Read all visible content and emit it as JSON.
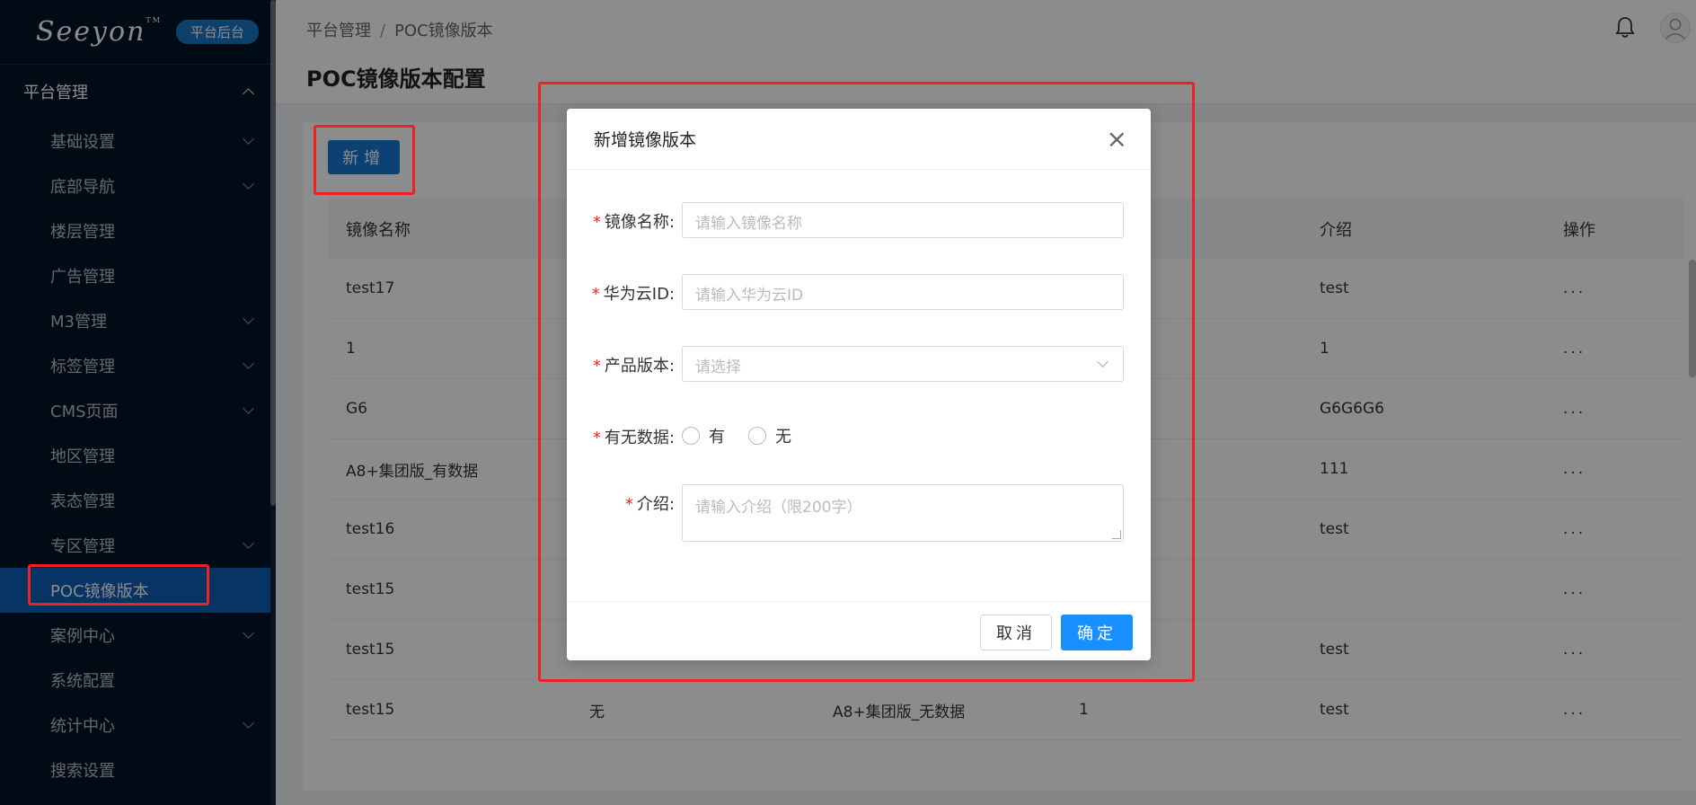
{
  "app": {
    "logo_text": "Seeyon",
    "logo_tm": "TM",
    "badge": "平台后台"
  },
  "sidebar": {
    "group_label": "平台管理",
    "items": [
      {
        "label": "基础设置",
        "has_children": true
      },
      {
        "label": "底部导航",
        "has_children": true
      },
      {
        "label": "楼层管理",
        "has_children": false
      },
      {
        "label": "广告管理",
        "has_children": false
      },
      {
        "label": "M3管理",
        "has_children": true
      },
      {
        "label": "标签管理",
        "has_children": true
      },
      {
        "label": "CMS页面",
        "has_children": true
      },
      {
        "label": "地区管理",
        "has_children": false
      },
      {
        "label": "表态管理",
        "has_children": false
      },
      {
        "label": "专区管理",
        "has_children": true
      },
      {
        "label": "POC镜像版本",
        "has_children": false,
        "active": true
      },
      {
        "label": "案例中心",
        "has_children": true
      },
      {
        "label": "系统配置",
        "has_children": false
      },
      {
        "label": "统计中心",
        "has_children": true
      },
      {
        "label": "搜索设置",
        "has_children": false
      }
    ]
  },
  "header": {
    "breadcrumb": [
      "平台管理",
      "POC镜像版本"
    ],
    "breadcrumb_sep": "/",
    "title": "POC镜像版本配置"
  },
  "toolbar": {
    "add_label": "新增"
  },
  "table": {
    "columns": [
      "镜像名称",
      "",
      "",
      "",
      "介绍",
      "操作"
    ],
    "rows": [
      [
        "test17",
        "",
        "",
        "",
        "test",
        "..."
      ],
      [
        "1",
        "",
        "",
        "",
        "1",
        "..."
      ],
      [
        "G6",
        "",
        "",
        "",
        "G6G6G6",
        "..."
      ],
      [
        "A8+集团版_有数据",
        "",
        "",
        "",
        "111",
        "..."
      ],
      [
        "test16",
        "",
        "",
        "",
        "test",
        "..."
      ],
      [
        "test15",
        "",
        "",
        "",
        "",
        "..."
      ],
      [
        "test15",
        "",
        "",
        "",
        "test",
        "..."
      ],
      [
        "test15",
        "无",
        "A8+集团版_无数据",
        "1",
        "test",
        "..."
      ]
    ]
  },
  "modal": {
    "title": "新增镜像版本",
    "close": "×",
    "fields": {
      "name": {
        "label": "镜像名称:",
        "placeholder": "请输入镜像名称"
      },
      "cloud_id": {
        "label": "华为云ID:",
        "placeholder": "请输入华为云ID"
      },
      "version": {
        "label": "产品版本:",
        "placeholder": "请选择"
      },
      "has_data": {
        "label": "有无数据:",
        "options": [
          "有",
          "无"
        ]
      },
      "intro": {
        "label": "介绍:",
        "placeholder": "请输入介绍（限200字）"
      }
    },
    "required_mark": "*",
    "cancel_label": "取消",
    "ok_label": "确定"
  },
  "colors": {
    "sidebar_bg": "#001529",
    "active_item": "#0f5db8",
    "primary": "#1890ff",
    "annotation": "#ee2222"
  }
}
